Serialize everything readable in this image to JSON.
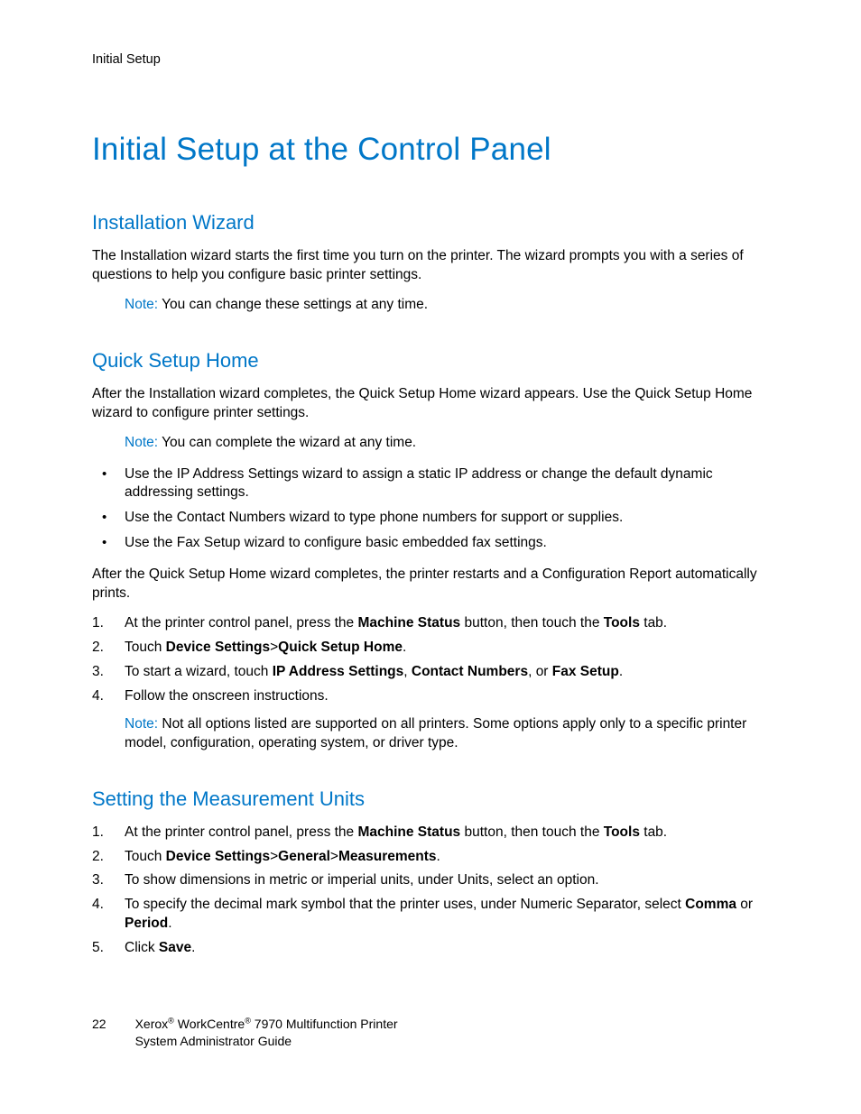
{
  "runningHeader": "Initial Setup",
  "mainTitle": "Initial Setup at the Control Panel",
  "sections": {
    "installation": {
      "title": "Installation Wizard",
      "para": "The Installation wizard starts the first time you turn on the printer. The wizard prompts you with a series of questions to help you configure basic printer settings.",
      "noteLabel": "Note:",
      "noteText": " You can change these settings at any time."
    },
    "quickSetup": {
      "title": "Quick Setup Home",
      "para1": "After the Installation wizard completes, the Quick Setup Home wizard appears. Use the Quick Setup Home wizard to configure printer settings.",
      "noteLabel": "Note:",
      "noteText": " You can complete the wizard at any time.",
      "bullets": [
        "Use the IP Address Settings wizard to assign a static IP address or change the default dynamic addressing settings.",
        "Use the Contact Numbers wizard to type phone numbers for support or supplies.",
        "Use the Fax Setup wizard to configure basic embedded fax settings."
      ],
      "para2": "After the Quick Setup Home wizard completes, the printer restarts and a Configuration Report automatically prints.",
      "steps": {
        "s1_a": "At the printer control panel, press the ",
        "s1_b": "Machine Status",
        "s1_c": " button, then touch the ",
        "s1_d": "Tools",
        "s1_e": " tab.",
        "s2_a": "Touch ",
        "s2_b": "Device Settings",
        "s2_c": ">",
        "s2_d": "Quick Setup Home",
        "s2_e": ".",
        "s3_a": "To start a wizard, touch ",
        "s3_b": "IP Address Settings",
        "s3_c": ", ",
        "s3_d": "Contact Numbers",
        "s3_e": ", or ",
        "s3_f": "Fax Setup",
        "s3_g": ".",
        "s4": "Follow the onscreen instructions."
      },
      "stepNoteLabel": "Note:",
      "stepNoteText": " Not all options listed are supported on all printers. Some options apply only to a specific printer model, configuration, operating system, or driver type."
    },
    "measurement": {
      "title": "Setting the Measurement Units",
      "steps": {
        "s1_a": "At the printer control panel, press the ",
        "s1_b": "Machine Status",
        "s1_c": " button, then touch the ",
        "s1_d": "Tools",
        "s1_e": " tab.",
        "s2_a": "Touch ",
        "s2_b": "Device Settings",
        "s2_c": ">",
        "s2_d": "General",
        "s2_e": ">",
        "s2_f": "Measurements",
        "s2_g": ".",
        "s3": "To show dimensions in metric or imperial units, under Units, select an option.",
        "s4_a": "To specify the decimal mark symbol that the printer uses, under Numeric Separator, select ",
        "s4_b": "Comma",
        "s4_c": " or ",
        "s4_d": "Period",
        "s4_e": ".",
        "s5_a": "Click ",
        "s5_b": "Save",
        "s5_c": "."
      }
    }
  },
  "footer": {
    "pageNumber": "22",
    "line1a": "Xerox",
    "line1b": " WorkCentre",
    "line1c": " 7970 Multifunction Printer",
    "line2": "System Administrator Guide",
    "reg": "®"
  }
}
